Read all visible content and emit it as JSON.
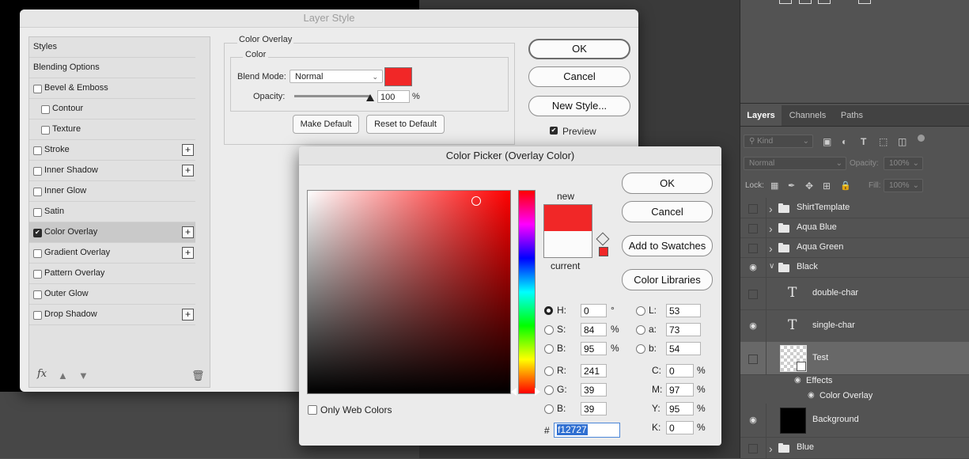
{
  "layer_style": {
    "title": "Layer Style",
    "styles": [
      {
        "label": "Styles",
        "checkbox": false,
        "indent": 0,
        "checked": false,
        "plus": false,
        "selected": false
      },
      {
        "label": "Blending Options",
        "checkbox": false,
        "indent": 0,
        "checked": false,
        "plus": false,
        "selected": false
      },
      {
        "label": "Bevel & Emboss",
        "checkbox": true,
        "indent": 0,
        "checked": false,
        "plus": false,
        "selected": false
      },
      {
        "label": "Contour",
        "checkbox": true,
        "indent": 1,
        "checked": false,
        "plus": false,
        "selected": false
      },
      {
        "label": "Texture",
        "checkbox": true,
        "indent": 1,
        "checked": false,
        "plus": false,
        "selected": false
      },
      {
        "label": "Stroke",
        "checkbox": true,
        "indent": 0,
        "checked": false,
        "plus": true,
        "selected": false
      },
      {
        "label": "Inner Shadow",
        "checkbox": true,
        "indent": 0,
        "checked": false,
        "plus": true,
        "selected": false
      },
      {
        "label": "Inner Glow",
        "checkbox": true,
        "indent": 0,
        "checked": false,
        "plus": false,
        "selected": false
      },
      {
        "label": "Satin",
        "checkbox": true,
        "indent": 0,
        "checked": false,
        "plus": false,
        "selected": false
      },
      {
        "label": "Color Overlay",
        "checkbox": true,
        "indent": 0,
        "checked": true,
        "plus": true,
        "selected": true
      },
      {
        "label": "Gradient Overlay",
        "checkbox": true,
        "indent": 0,
        "checked": false,
        "plus": true,
        "selected": false
      },
      {
        "label": "Pattern Overlay",
        "checkbox": true,
        "indent": 0,
        "checked": false,
        "plus": false,
        "selected": false
      },
      {
        "label": "Outer Glow",
        "checkbox": true,
        "indent": 0,
        "checked": false,
        "plus": false,
        "selected": false
      },
      {
        "label": "Drop Shadow",
        "checkbox": true,
        "indent": 0,
        "checked": false,
        "plus": true,
        "selected": false
      }
    ],
    "footer_fx": "fx",
    "section_title": "Color Overlay",
    "subsection_title": "Color",
    "blend_mode_label": "Blend Mode:",
    "blend_mode_value": "Normal",
    "overlay_color": "#f12727",
    "opacity_label": "Opacity:",
    "opacity_value": "100",
    "opacity_unit": "%",
    "opacity_fraction": 1.0,
    "make_default": "Make Default",
    "reset_default": "Reset to Default",
    "ok": "OK",
    "cancel": "Cancel",
    "new_style": "New Style...",
    "preview_label": "Preview",
    "preview_checked": true
  },
  "color_picker": {
    "title": "Color Picker (Overlay Color)",
    "new_label": "new",
    "current_label": "current",
    "new_color": "#f12727",
    "current_color": "#fbfbfb",
    "ok": "OK",
    "cancel": "Cancel",
    "add_to_swatches": "Add to Swatches",
    "color_libraries": "Color Libraries",
    "only_web_colors": "Only Web Colors",
    "hsb": [
      {
        "label": "H:",
        "value": "0",
        "unit": "°",
        "selected": true
      },
      {
        "label": "S:",
        "value": "84",
        "unit": "%",
        "selected": false
      },
      {
        "label": "B:",
        "value": "95",
        "unit": "%",
        "selected": false
      }
    ],
    "rgb": [
      {
        "label": "R:",
        "value": "241"
      },
      {
        "label": "G:",
        "value": "39"
      },
      {
        "label": "B:",
        "value": "39"
      }
    ],
    "lab": [
      {
        "label": "L:",
        "value": "53"
      },
      {
        "label": "a:",
        "value": "73"
      },
      {
        "label": "b:",
        "value": "54"
      }
    ],
    "cmyk": [
      {
        "label": "C:",
        "value": "0",
        "unit": "%"
      },
      {
        "label": "M:",
        "value": "97",
        "unit": "%"
      },
      {
        "label": "Y:",
        "value": "95",
        "unit": "%"
      },
      {
        "label": "K:",
        "value": "0",
        "unit": "%"
      }
    ],
    "hex_label": "#",
    "hex_value": "f12727"
  },
  "layers_panel": {
    "tabs": [
      {
        "label": "Layers",
        "active": true
      },
      {
        "label": "Channels",
        "active": false
      },
      {
        "label": "Paths",
        "active": false
      }
    ],
    "filter_kind": "Kind",
    "blend_mode": "Normal",
    "opacity_label": "Opacity:",
    "opacity_value": "100%",
    "lock_label": "Lock:",
    "fill_label": "Fill:",
    "fill_value": "100%",
    "layers": [
      {
        "name": "ShirtTemplate",
        "type": "folder",
        "visible": false,
        "expanded": false
      },
      {
        "name": "Aqua Blue",
        "type": "folder",
        "visible": false,
        "expanded": false
      },
      {
        "name": "Aqua Green",
        "type": "folder",
        "visible": false,
        "expanded": false
      },
      {
        "name": "Black",
        "type": "folder",
        "visible": true,
        "expanded": true
      },
      {
        "name": "double-char",
        "type": "text",
        "visible": false
      },
      {
        "name": "single-char",
        "type": "text",
        "visible": true
      },
      {
        "name": "Test",
        "type": "smart",
        "visible": false,
        "selected": true
      },
      {
        "name": "Effects",
        "type": "effects"
      },
      {
        "name": "Color Overlay",
        "type": "effect"
      },
      {
        "name": "Background",
        "type": "fill",
        "visible": true
      },
      {
        "name": "Blue",
        "type": "folder",
        "visible": false,
        "expanded": false
      }
    ]
  }
}
